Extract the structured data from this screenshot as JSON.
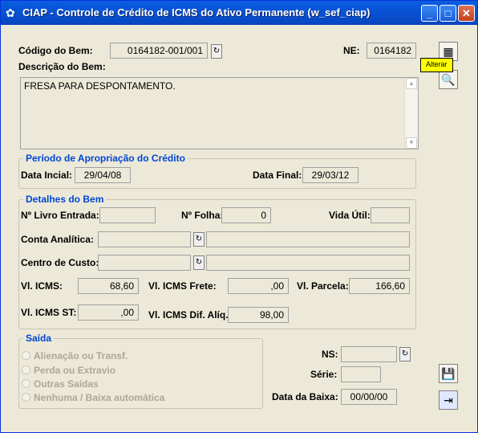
{
  "window": {
    "title": "CIAP - Controle de Crédito de ICMS do Ativo Permanente (w_sef_ciap)",
    "buttons": {
      "minimize": "_",
      "maximize": "□",
      "close": "✕"
    }
  },
  "form": {
    "codigo_label": "Código do Bem:",
    "codigo_value": "0164182-001/001",
    "ne_label": "NE:",
    "ne_value": "0164182",
    "descricao_label": "Descrição do Bem:",
    "descricao_value": "FRESA PARA DESPONTAMENTO."
  },
  "tooltip": "Alterar",
  "periodo": {
    "title": "Período de Apropriação do Crédito",
    "data_inicial_label": "Data Incial:",
    "data_inicial_value": "29/04/08",
    "data_final_label": "Data Final:",
    "data_final_value": "29/03/12"
  },
  "detalhes": {
    "title": "Detalhes do Bem",
    "livro_label": "Nº Livro Entrada:",
    "livro_value": "",
    "folha_label": "Nº Folha:",
    "folha_value": "0",
    "vida_label": "Vida Útil:",
    "vida_value": "",
    "conta_label": "Conta Analítica:",
    "conta_value": "",
    "conta_desc": "",
    "centro_label": "Centro de Custo:",
    "centro_value": "",
    "centro_desc": "",
    "icms_label": "Vl. ICMS:",
    "icms_value": "68,60",
    "frete_label": "Vl. ICMS Frete:",
    "frete_value": ",00",
    "parcela_label": "Vl. Parcela:",
    "parcela_value": "166,60",
    "st_label": "Vl. ICMS ST:",
    "st_value": ",00",
    "difal_label": "Vl. ICMS Dif. Alíq.:",
    "difal_value": "98,00"
  },
  "saida": {
    "title": "Saída",
    "options": [
      "Alienação ou Transf.",
      "Perda ou Extravio",
      "Outras Saídas",
      "Nenhuma / Baixa automática"
    ],
    "ns_label": "NS:",
    "ns_value": "",
    "serie_label": "Série:",
    "serie_value": "",
    "data_baixa_label": "Data da Baixa:",
    "data_baixa_value": "00/00/00"
  }
}
